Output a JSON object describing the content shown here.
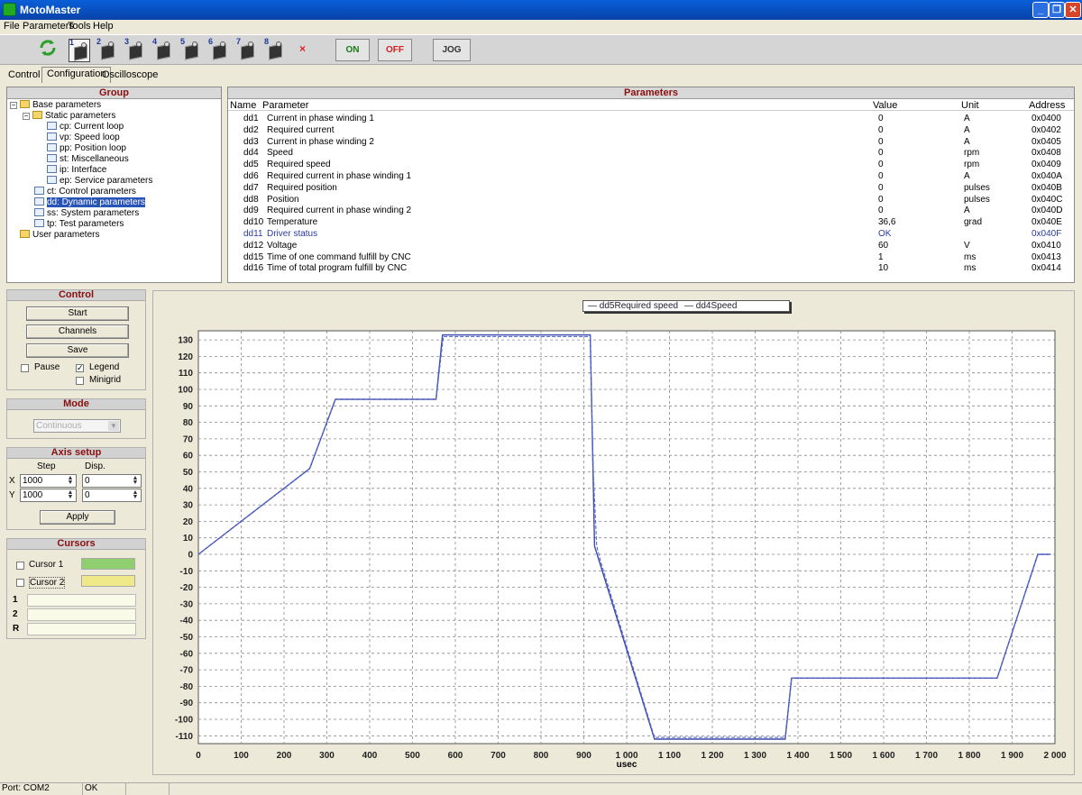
{
  "app": {
    "title": "MotoMaster"
  },
  "menu": [
    "File",
    "Parameters",
    "Tools",
    "Help"
  ],
  "toolbar": {
    "motors": [
      "1",
      "2",
      "3",
      "4",
      "5",
      "6",
      "7",
      "8"
    ],
    "close_symbol": "×",
    "on_label": "ON",
    "off_label": "OFF",
    "jog_label": "JOG",
    "on_color": "#1a7a1a",
    "off_color": "#d02020"
  },
  "tabs": [
    "Control",
    "Configuration",
    "Oscilloscope"
  ],
  "group": {
    "title": "Group",
    "items": [
      {
        "label": "Base parameters"
      },
      {
        "label": "Static parameters"
      },
      {
        "label": "cp: Current loop"
      },
      {
        "label": "vp: Speed loop"
      },
      {
        "label": "pp: Position loop"
      },
      {
        "label": "st: Miscellaneous"
      },
      {
        "label": "ip: Interface"
      },
      {
        "label": "ep: Service parameters"
      },
      {
        "label": "ct: Control parameters"
      },
      {
        "label": "dd: Dynamic parameters"
      },
      {
        "label": "ss: System parameters"
      },
      {
        "label": "tp: Test parameters"
      },
      {
        "label": "User parameters"
      }
    ]
  },
  "parameters": {
    "title": "Parameters",
    "columns": [
      "Name",
      "Parameter",
      "Value",
      "Unit",
      "Address"
    ],
    "rows": [
      {
        "name": "dd1",
        "param": "Current in phase winding 1",
        "value": "0",
        "unit": "A",
        "address": "0x0400"
      },
      {
        "name": "dd2",
        "param": "Required current",
        "value": "0",
        "unit": "A",
        "address": "0x0402"
      },
      {
        "name": "dd3",
        "param": "Current in phase winding 2",
        "value": "0",
        "unit": "A",
        "address": "0x0405"
      },
      {
        "name": "dd4",
        "param": "Speed",
        "value": "0",
        "unit": "rpm",
        "address": "0x0408"
      },
      {
        "name": "dd5",
        "param": "Required speed",
        "value": "0",
        "unit": "rpm",
        "address": "0x0409"
      },
      {
        "name": "dd6",
        "param": "Required current in phase winding 1",
        "value": "0",
        "unit": "A",
        "address": "0x040A"
      },
      {
        "name": "dd7",
        "param": "Required position",
        "value": "0",
        "unit": "pulses",
        "address": "0x040B"
      },
      {
        "name": "dd8",
        "param": "Position",
        "value": "0",
        "unit": "pulses",
        "address": "0x040C"
      },
      {
        "name": "dd9",
        "param": "Required current in phase winding 2",
        "value": "0",
        "unit": "A",
        "address": "0x040D"
      },
      {
        "name": "dd10",
        "param": "Temperature",
        "value": "36,6",
        "unit": "grad",
        "address": "0x040E"
      },
      {
        "name": "dd11",
        "param": "Driver status",
        "value": "OK",
        "unit": "",
        "address": "0x040F"
      },
      {
        "name": "dd12",
        "param": "Voltage",
        "value": "60",
        "unit": "V",
        "address": "0x0410"
      },
      {
        "name": "dd15",
        "param": "Time of one command fulfill by CNC",
        "value": "1",
        "unit": "ms",
        "address": "0x0413"
      },
      {
        "name": "dd16",
        "param": "Time of total program fulfill by CNC",
        "value": "10",
        "unit": "ms",
        "address": "0x0414"
      }
    ]
  },
  "control": {
    "title": "Control",
    "start": "Start",
    "channels": "Channels",
    "save": "Save",
    "pause": "Pause",
    "legend": "Legend",
    "minigrid": "Minigrid",
    "legend_checked": true,
    "pause_checked": false,
    "minigrid_checked": false
  },
  "mode": {
    "title": "Mode",
    "value": "Continuous"
  },
  "axis": {
    "title": "Axis setup",
    "step": "Step",
    "disp": "Disp.",
    "x_label": "X",
    "y_label": "Y",
    "x_step": "1000",
    "x_disp": "0",
    "y_step": "1000",
    "y_disp": "0",
    "apply": "Apply"
  },
  "cursors": {
    "title": "Cursors",
    "cursor1": "Cursor 1",
    "cursor2": "Cursor 2",
    "cursor1_color": "#8fcf6f",
    "cursor2_color": "#efe98a",
    "row1": "1",
    "row2": "2",
    "rowR": "R"
  },
  "status": {
    "port": "Port: COM2",
    "state": "OK"
  },
  "chart_data": {
    "type": "line",
    "xlabel": "usec",
    "xlim": [
      0,
      2000
    ],
    "ylim": [
      -120,
      135
    ],
    "xticks": [
      "0",
      "100",
      "200",
      "300",
      "400",
      "500",
      "600",
      "700",
      "800",
      "900",
      "1 000",
      "1 100",
      "1 200",
      "1 300",
      "1 400",
      "1 500",
      "1 600",
      "1 700",
      "1 800",
      "1 900",
      "2 000"
    ],
    "yticks": [
      130,
      120,
      110,
      100,
      90,
      80,
      70,
      60,
      50,
      40,
      30,
      20,
      10,
      0,
      -10,
      -20,
      -30,
      -40,
      -50,
      -60,
      -70,
      -80,
      -90,
      -100,
      -110
    ],
    "grid": true,
    "legend": [
      "dd5Required speed",
      "dd4Speed"
    ],
    "series": [
      {
        "name": "dd5Required speed",
        "color": "#3a4aa8",
        "x": [
          0,
          260,
          320,
          555,
          570,
          915,
          925,
          1065,
          1370,
          1385,
          1865,
          1960,
          1990
        ],
        "y": [
          0,
          52,
          94,
          94,
          133,
          133,
          5,
          -112,
          -112,
          -75,
          -75,
          0,
          0
        ]
      },
      {
        "name": "dd4Speed",
        "color": "#5a6ad0",
        "x": [
          0,
          260,
          320,
          555,
          572,
          915,
          922,
          930,
          940,
          1065,
          1370,
          1385,
          1865,
          1960,
          1990
        ],
        "y": [
          0,
          52,
          94,
          94,
          132,
          132,
          50,
          5,
          -5,
          -111,
          -111,
          -75,
          -75,
          0,
          0
        ]
      }
    ]
  }
}
